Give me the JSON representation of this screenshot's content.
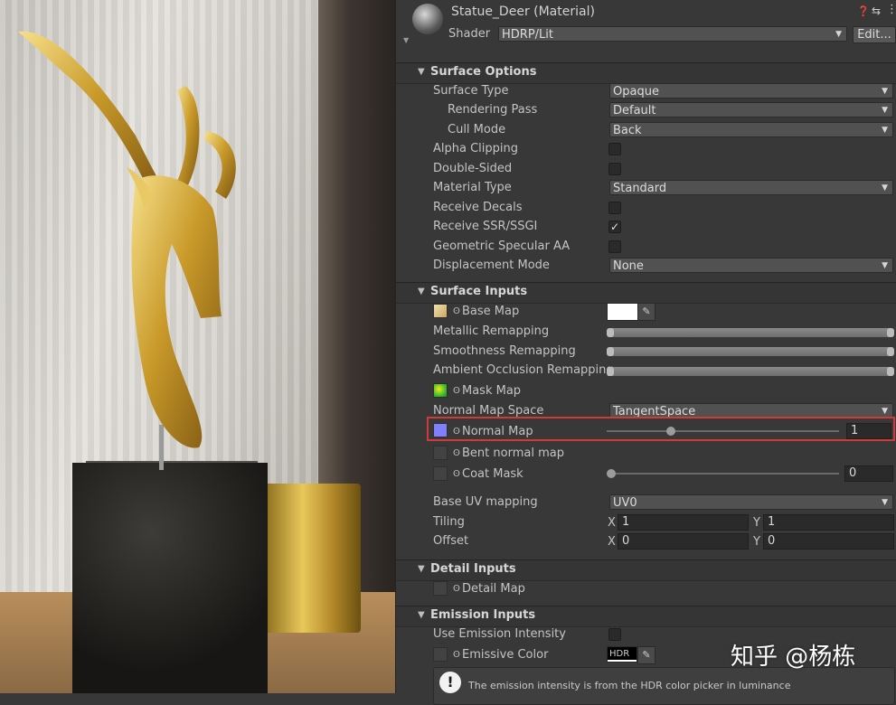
{
  "material": {
    "name": "Statue_Deer (Material)",
    "shader_label": "Shader",
    "shader_value": "HDRP/Lit",
    "edit_label": "Edit...",
    "icons": [
      "help-icon",
      "preset-icon",
      "more-icon"
    ]
  },
  "surface_options": {
    "title": "Surface Options",
    "surface_type": {
      "label": "Surface Type",
      "value": "Opaque"
    },
    "rendering_pass": {
      "label": "Rendering Pass",
      "value": "Default"
    },
    "cull_mode": {
      "label": "Cull Mode",
      "value": "Back"
    },
    "alpha_clipping": {
      "label": "Alpha Clipping",
      "checked": false
    },
    "double_sided": {
      "label": "Double-Sided",
      "checked": false
    },
    "material_type": {
      "label": "Material Type",
      "value": "Standard"
    },
    "receive_decals": {
      "label": "Receive Decals",
      "checked": false
    },
    "receive_ssr": {
      "label": "Receive SSR/SSGI",
      "checked": true,
      "check_glyph": "✓"
    },
    "specular_aa": {
      "label": "Geometric Specular AA",
      "checked": false
    },
    "displacement": {
      "label": "Displacement Mode",
      "value": "None"
    }
  },
  "surface_inputs": {
    "title": "Surface Inputs",
    "base_map": {
      "label": "Base Map",
      "color": "#ffffff"
    },
    "metallic_remap": {
      "label": "Metallic Remapping"
    },
    "smoothness_remap": {
      "label": "Smoothness Remapping"
    },
    "ao_remap": {
      "label": "Ambient Occlusion Remapping"
    },
    "mask_map": {
      "label": "Mask Map"
    },
    "normal_space": {
      "label": "Normal Map Space",
      "value": "TangentSpace"
    },
    "normal_map": {
      "label": "Normal Map",
      "value": "1",
      "slider_fraction": 0.14,
      "highlight_color": "#d23a3a"
    },
    "bent_normal": {
      "label": "Bent normal map"
    },
    "coat_mask": {
      "label": "Coat Mask",
      "value": "0",
      "slider_fraction": 0.0
    },
    "uv_mapping": {
      "label": "Base UV mapping",
      "value": "UV0"
    },
    "tiling": {
      "label": "Tiling",
      "x_label": "X",
      "x": "1",
      "y_label": "Y",
      "y": "1"
    },
    "offset": {
      "label": "Offset",
      "x_label": "X",
      "x": "0",
      "y_label": "Y",
      "y": "0"
    }
  },
  "detail_inputs": {
    "title": "Detail Inputs",
    "detail_map": {
      "label": "Detail Map"
    }
  },
  "emission_inputs": {
    "title": "Emission Inputs",
    "use_intensity": {
      "label": "Use Emission Intensity",
      "checked": false
    },
    "emissive_color": {
      "label": "Emissive Color",
      "hdr_label": "HDR"
    },
    "info_icon_glyph": "!",
    "info_text": "The emission intensity is from the HDR color picker in luminance"
  },
  "watermark": "知乎 @杨栋"
}
